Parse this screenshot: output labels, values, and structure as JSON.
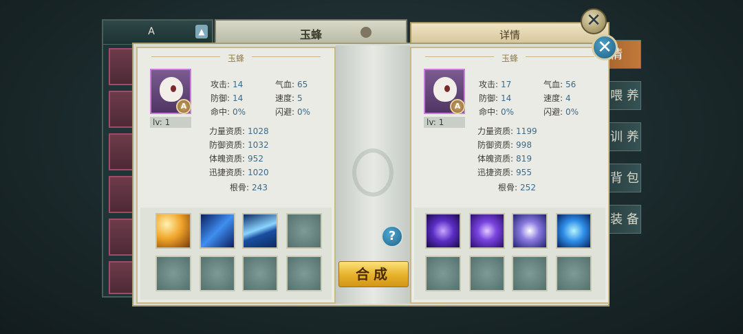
{
  "background": {
    "filter_label": "A",
    "center_title": "玉蜂",
    "right_header": "详情",
    "tabs": [
      "情",
      "喂 养",
      "训 养",
      "背 包",
      "装 备"
    ]
  },
  "modal": {
    "help_label": "?",
    "merge_label": "合成",
    "left_pet": {
      "name": "玉蜂",
      "grade": "A",
      "level": "lv: 1",
      "stats": {
        "attack_label": "攻击:",
        "attack": "14",
        "hp_label": "气血:",
        "hp": "65",
        "defense_label": "防御:",
        "defense": "14",
        "speed_label": "速度:",
        "speed": "5",
        "hit_label": "命中:",
        "hit": "0%",
        "dodge_label": "闪避:",
        "dodge": "0%"
      },
      "aptitudes": {
        "power_label": "力量资质:",
        "power": "1028",
        "def_label": "防御资质:",
        "def": "1032",
        "phys_label": "体魄资质:",
        "phys": "952",
        "agi_label": "迅捷资质:",
        "agi": "1020",
        "root_label": "根骨:",
        "root": "243"
      },
      "skills": [
        "gold-claw-skill-icon",
        "blue-slash-skill-icon",
        "blue-wind-skill-icon"
      ]
    },
    "right_pet": {
      "name": "玉蜂",
      "grade": "A",
      "level": "lv: 1",
      "stats": {
        "attack_label": "攻击:",
        "attack": "17",
        "hp_label": "气血:",
        "hp": "56",
        "defense_label": "防御:",
        "defense": "14",
        "speed_label": "速度:",
        "speed": "4",
        "hit_label": "命中:",
        "hit": "0%",
        "dodge_label": "闪避:",
        "dodge": "0%"
      },
      "aptitudes": {
        "power_label": "力量资质:",
        "power": "1199",
        "def_label": "防御资质:",
        "def": "998",
        "phys_label": "体魄资质:",
        "phys": "819",
        "agi_label": "迅捷资质:",
        "agi": "955",
        "root_label": "根骨:",
        "root": "252"
      },
      "skills": [
        "purple-vortex-skill-icon",
        "purple-column-skill-icon",
        "purple-swirl-skill-icon",
        "cyan-beast-skill-icon"
      ]
    }
  }
}
